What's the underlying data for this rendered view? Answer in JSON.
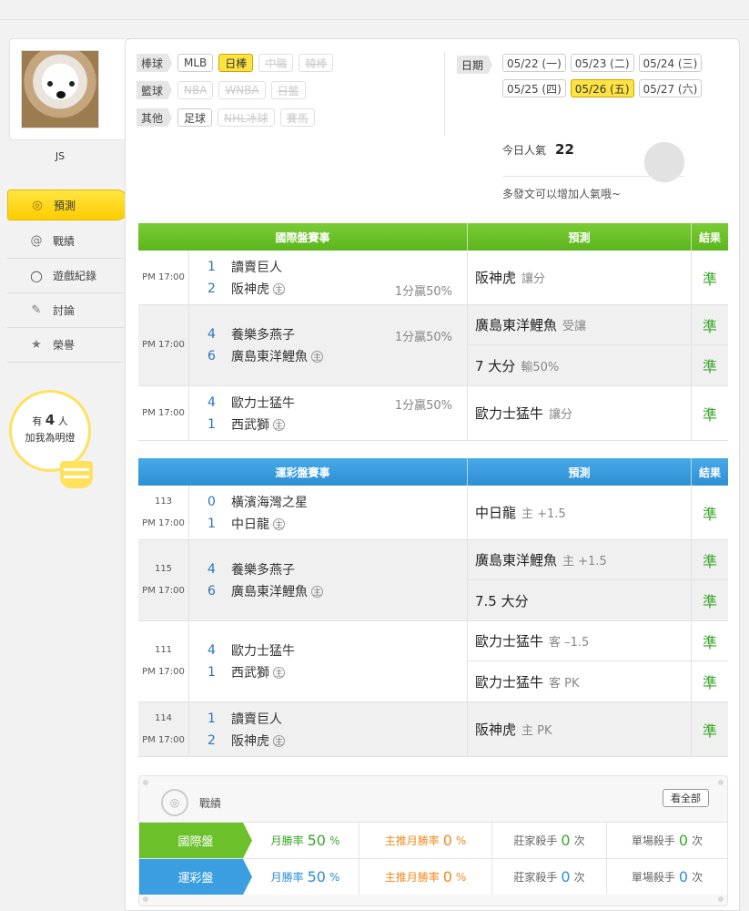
{
  "user": {
    "name": "JS"
  },
  "nav": [
    {
      "label": "預測",
      "icon": "target-icon",
      "active": true
    },
    {
      "label": "戰績",
      "icon": "spiral-icon"
    },
    {
      "label": "遊戲紀錄",
      "icon": "circle-icon"
    },
    {
      "label": "討論",
      "icon": "chat-icon"
    },
    {
      "label": "榮譽",
      "icon": "medal-icon"
    }
  ],
  "fans": {
    "prefix": "有",
    "count": "4",
    "unit": "人",
    "suffix": "加我為明燈"
  },
  "filters": {
    "baseball": {
      "label": "棒球",
      "items": [
        "MLB",
        "日棒",
        "中職",
        "韓棒"
      ]
    },
    "basketball": {
      "label": "籃球",
      "items": [
        "NBA",
        "WNBA",
        "日籃"
      ]
    },
    "other": {
      "label": "其他",
      "items": [
        "足球",
        "NHL冰球",
        "賽馬"
      ]
    }
  },
  "dates": {
    "label": "日期",
    "items": [
      "05/22 (一)",
      "05/23 (二)",
      "05/24 (三)",
      "05/25 (四)",
      "05/26 (五)",
      "05/27 (六)"
    ]
  },
  "popularity": {
    "label": "今日人氣",
    "value": "22",
    "hint": "多發文可以增加人氣哦~"
  },
  "intl_table": {
    "headers": {
      "game": "國際盤賽事",
      "pred": "預測",
      "result": "結果"
    },
    "rows": [
      {
        "time": "PM 17:00",
        "t1_score": "1",
        "t1": "讀賣巨人",
        "t2_score": "2",
        "t2": "阪神虎",
        "home": "主",
        "handicap": "1分贏50%",
        "preds": [
          {
            "main": "阪神虎",
            "sub": "讓分",
            "res": "準"
          }
        ]
      },
      {
        "time": "PM 17:00",
        "t1_score": "4",
        "t1": "養樂多燕子",
        "t2_score": "6",
        "t2": "廣島東洋鯉魚",
        "home": "主",
        "handicap": "1分贏50%",
        "preds": [
          {
            "main": "廣島東洋鯉魚",
            "sub": "受讓",
            "res": "準"
          },
          {
            "main": "7 大分",
            "sub": "輸50%",
            "res": "準"
          }
        ]
      },
      {
        "time": "PM 17:00",
        "t1_score": "4",
        "t1": "歐力士猛牛",
        "t2_score": "1",
        "t2": "西武獅",
        "home": "主",
        "handicap": "1分贏50%",
        "preds": [
          {
            "main": "歐力士猛牛",
            "sub": "讓分",
            "res": "準"
          }
        ]
      }
    ]
  },
  "lottery_table": {
    "headers": {
      "game": "運彩盤賽事",
      "pred": "預測",
      "result": "結果"
    },
    "rows": [
      {
        "num": "113",
        "time": "PM 17:00",
        "t1_score": "0",
        "t1": "橫濱海灣之星",
        "t2_score": "1",
        "t2": "中日龍",
        "home": "主",
        "preds": [
          {
            "main": "中日龍",
            "sub": "主 +1.5",
            "res": "準"
          }
        ]
      },
      {
        "num": "115",
        "time": "PM 17:00",
        "t1_score": "4",
        "t1": "養樂多燕子",
        "t2_score": "6",
        "t2": "廣島東洋鯉魚",
        "home": "主",
        "preds": [
          {
            "main": "廣島東洋鯉魚",
            "sub": "主 +1.5",
            "res": "準"
          },
          {
            "main": "7.5 大分",
            "sub": "",
            "res": "準"
          }
        ]
      },
      {
        "num": "111",
        "time": "PM 17:00",
        "t1_score": "4",
        "t1": "歐力士猛牛",
        "t2_score": "1",
        "t2": "西武獅",
        "home": "主",
        "preds": [
          {
            "main": "歐力士猛牛",
            "sub": "客 –1.5",
            "res": "準"
          },
          {
            "main": "歐力士猛牛",
            "sub": "客 PK",
            "res": "準"
          }
        ]
      },
      {
        "num": "114",
        "time": "PM 17:00",
        "t1_score": "1",
        "t1": "讀賣巨人",
        "t2_score": "2",
        "t2": "阪神虎",
        "home": "主",
        "preds": [
          {
            "main": "阪神虎",
            "sub": "主 PK",
            "res": "準"
          }
        ]
      }
    ]
  },
  "stats": {
    "title": "戰績",
    "view_all": "看全部",
    "rows": [
      {
        "label": "國際盤",
        "color": "#6cc02a",
        "monthly_label": "月勝率",
        "monthly": "50",
        "pct": "%",
        "main_label": "主推月勝率",
        "main": "0",
        "banker_label": "莊家殺手",
        "banker": "0",
        "times": "次",
        "single_label": "單場殺手",
        "single": "0"
      },
      {
        "label": "運彩盤",
        "color": "#3a9ee0",
        "monthly_label": "月勝率",
        "monthly": "50",
        "pct": "%",
        "main_label": "主推月勝率",
        "main": "0",
        "banker_label": "莊家殺手",
        "banker": "0",
        "times": "次",
        "single_label": "單場殺手",
        "single": "0"
      }
    ]
  }
}
